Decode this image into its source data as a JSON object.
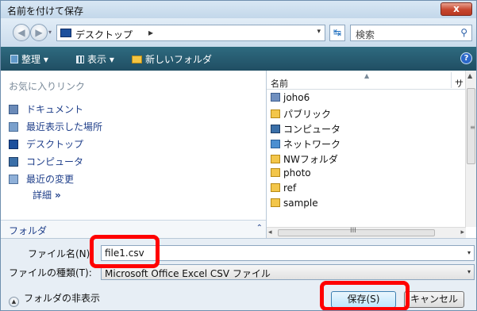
{
  "window": {
    "title": "名前を付けて保存",
    "close_glyph": "x"
  },
  "address": {
    "back_glyph": "◀",
    "forward_glyph": "▶",
    "recent_glyph": "▾",
    "location": "デスクトップ",
    "separator": "▸",
    "dropdown_glyph": "▾",
    "refresh_glyph": "↹",
    "search_placeholder": "検索",
    "search_glyph": "⚲"
  },
  "toolbar": {
    "organize": "整理 ▾",
    "view": "表示 ▾",
    "new_folder": "新しいフォルダ",
    "help_glyph": "?"
  },
  "favorites": {
    "header": "お気に入りリンク",
    "items": [
      {
        "label": "ドキュメント",
        "icon": "documents-icon"
      },
      {
        "label": "最近表示した場所",
        "icon": "recent-places-icon"
      },
      {
        "label": "デスクトップ",
        "icon": "desktop-icon"
      },
      {
        "label": "コンピュータ",
        "icon": "computer-icon"
      },
      {
        "label": "最近の変更",
        "icon": "recent-changes-icon"
      }
    ],
    "more": "詳細",
    "more_chevron": "»"
  },
  "folders": {
    "label": "フォルダ",
    "chevron": "⌃"
  },
  "filelist": {
    "columns": {
      "name": "名前",
      "size": "サ",
      "sort_glyph": "▲"
    },
    "items": [
      {
        "name": "joho6",
        "icon": "user-folder-icon"
      },
      {
        "name": "パブリック",
        "icon": "folder-icon"
      },
      {
        "name": "コンピュータ",
        "icon": "computer-icon"
      },
      {
        "name": "ネットワーク",
        "icon": "network-icon"
      },
      {
        "name": "NWフォルダ",
        "icon": "folder-icon"
      },
      {
        "name": "photo",
        "icon": "folder-icon"
      },
      {
        "name": "ref",
        "icon": "folder-icon"
      },
      {
        "name": "sample",
        "icon": "folder-icon"
      }
    ],
    "scroll": {
      "up": "▲",
      "grip": "≡",
      "left": "◂",
      "right": "▸",
      "hgrip": "III"
    }
  },
  "form": {
    "filename_label": "ファイル名(N):",
    "filename_value": "file1.csv",
    "filename_drop": "▾",
    "filetype_label": "ファイルの種類(T):",
    "filetype_value": "Microsoft Office Excel CSV ファイル",
    "filetype_drop": "▾",
    "hide_folders": "フォルダの非表示",
    "hide_glyph": "▲",
    "save": "保存(S)",
    "cancel": "キャンセル"
  },
  "colors": {
    "toolbar": "#2e6a7f",
    "highlight": "#ff0000",
    "close": "#c7462e"
  }
}
